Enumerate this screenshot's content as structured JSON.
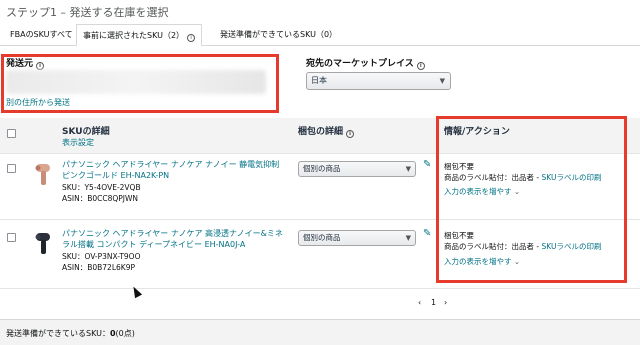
{
  "page": {
    "title": "ステップ1 – 発送する在庫を選択"
  },
  "tabs": [
    {
      "label": "FBAのSKUすべて"
    },
    {
      "label": "事前に選択されたSKU（2）"
    },
    {
      "label": "発送準備ができているSKU（0）"
    }
  ],
  "ship_from": {
    "label": "発送元",
    "other_address_link": "別の住所から発送"
  },
  "marketplace": {
    "label": "宛先のマーケットプレイス",
    "value": "日本"
  },
  "table": {
    "headers": {
      "sku": "SKUの詳細",
      "show_settings": "表示設定",
      "packing": "梱包の詳細",
      "info": "情報/アクション"
    },
    "rows": [
      {
        "name": "パナソニック ヘアドライヤー ナノケア ナノイー 静電気抑制 ピンクゴールド EH-NA2K-PN",
        "sku_label": "SKU：",
        "sku": "Y5-4OVE-2VQB",
        "asin_label": "ASIN：",
        "asin": "B0CC8QPJWN",
        "packing": "個別の商品",
        "action_line1": "梱包不要",
        "action_line2_prefix": "商品のラベル貼付：出品者 - ",
        "action_line2_link": "SKUラベルの印刷",
        "action_more": "入力の表示を増やす"
      },
      {
        "name": "パナソニック ヘアドライヤー ナノケア 高浸透ナノイー&ミネラル搭載 コンパクト ディープネイビー EH-NA0J-A",
        "sku_label": "SKU：",
        "sku": "OV-P3NX-T9OO",
        "asin_label": "ASIN：",
        "asin": "B0B72L6K9P",
        "packing": "個別の商品",
        "action_line1": "梱包不要",
        "action_line2_prefix": "商品のラベル貼付：出品者 - ",
        "action_line2_link": "SKUラベルの印刷",
        "action_more": "入力の表示を増やす"
      }
    ]
  },
  "pagination": {
    "prev": "‹",
    "page": "1",
    "next": "›"
  },
  "footer": {
    "label": "発送準備ができているSKU：",
    "count": "0",
    "points": "(0点)"
  },
  "colors": {
    "link": "#007185",
    "highlight": "#e53a2c"
  }
}
